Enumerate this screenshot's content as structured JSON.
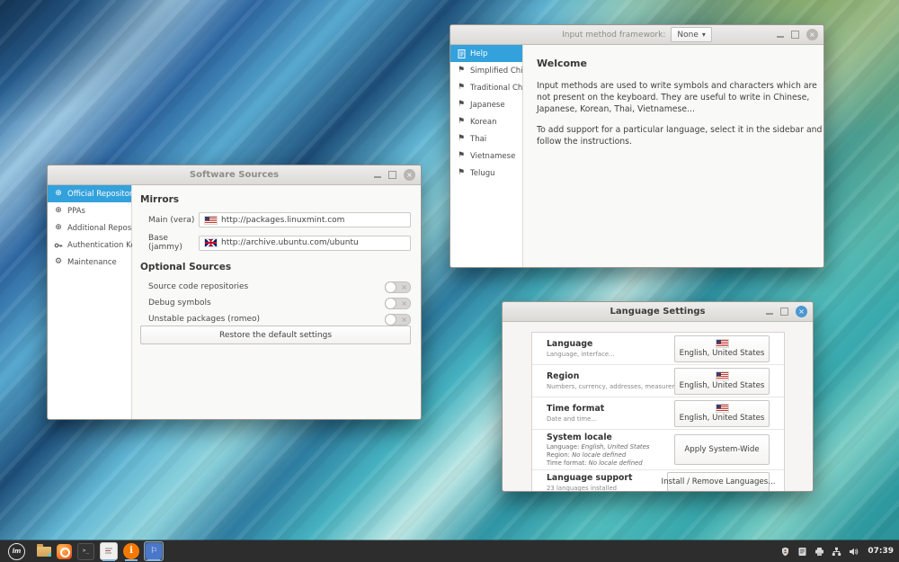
{
  "input_method_window": {
    "titlebar_label": "Input method framework:",
    "framework_dropdown_value": "None",
    "sidebar": {
      "items": [
        {
          "label": "Help",
          "icon": "help-doc-icon",
          "selected": true
        },
        {
          "label": "Simplified Chinese",
          "icon": "flag-icon",
          "selected": false
        },
        {
          "label": "Traditional Chinese",
          "icon": "flag-icon",
          "selected": false
        },
        {
          "label": "Japanese",
          "icon": "flag-icon",
          "selected": false
        },
        {
          "label": "Korean",
          "icon": "flag-icon",
          "selected": false
        },
        {
          "label": "Thai",
          "icon": "flag-icon",
          "selected": false
        },
        {
          "label": "Vietnamese",
          "icon": "flag-icon",
          "selected": false
        },
        {
          "label": "Telugu",
          "icon": "flag-icon",
          "selected": false
        }
      ]
    },
    "content": {
      "heading": "Welcome",
      "paragraph1": "Input methods are used to write symbols and characters which are not present on the keyboard. They are useful to write in Chinese, Japanese, Korean, Thai, Vietnamese...",
      "paragraph2": "To add support for a particular language, select it in the sidebar and follow the instructions."
    }
  },
  "software_sources_window": {
    "title": "Software Sources",
    "sidebar": {
      "items": [
        {
          "label": "Official Repositories",
          "icon": "globe-icon",
          "selected": true
        },
        {
          "label": "PPAs",
          "icon": "globe-icon",
          "selected": false
        },
        {
          "label": "Additional Repositories",
          "icon": "globe-icon",
          "selected": false
        },
        {
          "label": "Authentication Keys",
          "icon": "key-icon",
          "selected": false
        },
        {
          "label": "Maintenance",
          "icon": "gear-icon",
          "selected": false
        }
      ]
    },
    "mirrors_section": {
      "heading": "Mirrors",
      "main_label": "Main (vera)",
      "main_url": "http://packages.linuxmint.com",
      "main_flag": "us-flag-icon",
      "base_label": "Base (jammy)",
      "base_url": "http://archive.ubuntu.com/ubuntu",
      "base_flag": "uk-flag-icon"
    },
    "optional_section": {
      "heading": "Optional Sources",
      "toggles": [
        {
          "label": "Source code repositories",
          "state": "off"
        },
        {
          "label": "Debug symbols",
          "state": "off"
        },
        {
          "label": "Unstable packages (romeo)",
          "state": "off"
        }
      ]
    },
    "restore_button_label": "Restore the default settings"
  },
  "language_settings_window": {
    "title": "Language Settings",
    "rows": [
      {
        "title": "Language",
        "subtitle": "Language, interface...",
        "button_label": "English, United States",
        "button_flag": "us-flag-icon"
      },
      {
        "title": "Region",
        "subtitle": "Numbers, currency, addresses, measurement...",
        "button_label": "English, United States",
        "button_flag": "us-flag-icon"
      },
      {
        "title": "Time format",
        "subtitle": "Date and time...",
        "button_label": "English, United States",
        "button_flag": "us-flag-icon"
      },
      {
        "title": "System locale",
        "detail_lines": [
          {
            "label": "Language:",
            "value": "English, United States"
          },
          {
            "label": "Region:",
            "value": "No locale defined"
          },
          {
            "label": "Time format:",
            "value": "No locale defined"
          }
        ],
        "button_label": "Apply System-Wide"
      },
      {
        "title": "Language support",
        "subtitle": "23 languages installed",
        "button_label": "Install / Remove Languages..."
      }
    ]
  },
  "taskbar": {
    "menu_label": "lm",
    "launcher_icons": [
      "files-folder-icon",
      "firefox-icon",
      "terminal-icon"
    ],
    "window_list_icons": [
      "software-sources-icon",
      "input-method-icon",
      "language-settings-icon"
    ],
    "tray_icons": [
      "shield-icon",
      "report-icon",
      "printer-icon",
      "network-icon",
      "volume-icon"
    ],
    "clock": "07:39"
  },
  "colors": {
    "selection_blue": "#33a1dc",
    "active_close_blue": "#4a97d2",
    "taskbar_bg": "#2d2d2d",
    "titlebar_bg": "#e5e3e1",
    "info_icon_orange": "#f57900"
  }
}
